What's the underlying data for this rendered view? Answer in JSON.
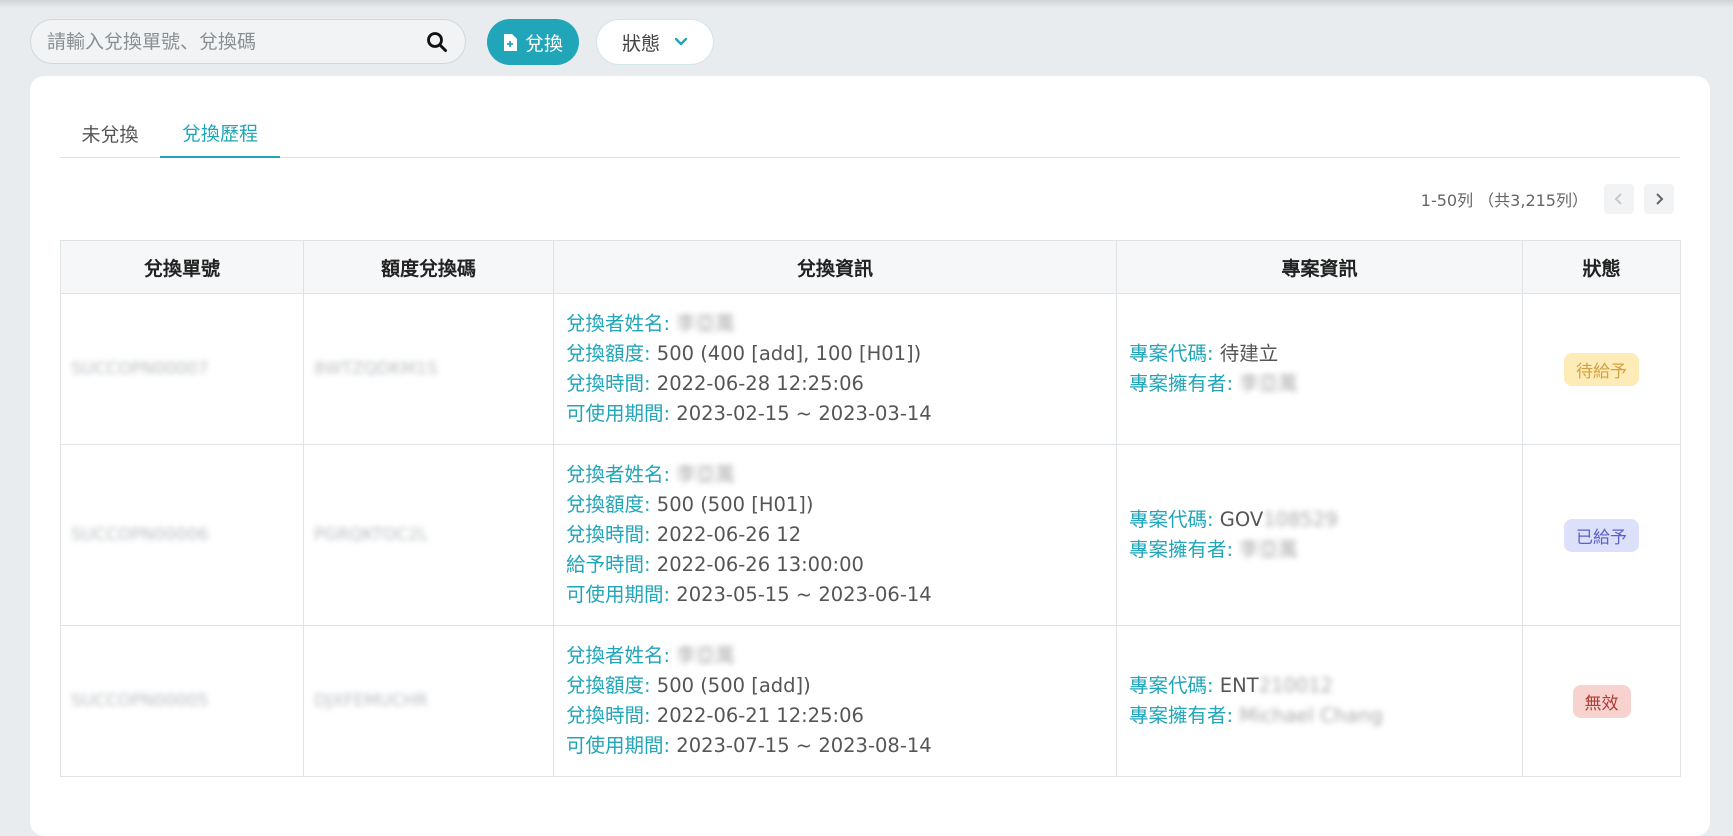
{
  "search": {
    "placeholder": "請輸入兌換單號、兌換碼"
  },
  "toolbar": {
    "exchange_label": "兌換",
    "status_label": "狀態"
  },
  "tabs": [
    {
      "label": "未兌換",
      "active": false
    },
    {
      "label": "兌換歷程",
      "active": true
    }
  ],
  "pagination": {
    "text": "1-50列 （共3,215列）"
  },
  "table": {
    "headers": [
      "兌換單號",
      "額度兌換碼",
      "兌換資訊",
      "專案資訊",
      "狀態"
    ],
    "rows": [
      {
        "order_no": "SUCCOPN00007",
        "code": "8WTZQDKM1S",
        "info": [
          {
            "label": "兌換者姓名:",
            "value": "李亞萬",
            "blurred": true
          },
          {
            "label": "兌換額度:",
            "value": "500 (400 [add], 100 [H01])"
          },
          {
            "label": "兌換時間:",
            "value": "2022-06-28 12:25:06"
          },
          {
            "label": "可使用期間:",
            "value": "2023-02-15 ~ 2023-03-14"
          }
        ],
        "project": {
          "code_label": "專案代碼:",
          "code_value": "待建立",
          "code_suffix": "",
          "owner_label": "專案擁有者:",
          "owner_value": "李亞萬"
        },
        "status": "待給予"
      },
      {
        "order_no": "SUCCOPN00006",
        "code": "PGRQKTOC2L",
        "info": [
          {
            "label": "兌換者姓名:",
            "value": "李亞萬",
            "blurred": true
          },
          {
            "label": "兌換額度:",
            "value": "500 (500 [H01])"
          },
          {
            "label": "兌換時間:",
            "value": "2022-06-26 12"
          },
          {
            "label": "給予時間:",
            "value": "2022-06-26 13:00:00"
          },
          {
            "label": "可使用期間:",
            "value": "2023-05-15 ~ 2023-06-14"
          }
        ],
        "project": {
          "code_label": "專案代碼:",
          "code_value": "GOV",
          "code_suffix": "108529",
          "owner_label": "專案擁有者:",
          "owner_value": "李亞萬"
        },
        "status": "已給予"
      },
      {
        "order_no": "SUCCOPN00005",
        "code": "DJXFEMUCHR",
        "info": [
          {
            "label": "兌換者姓名:",
            "value": "李亞萬",
            "blurred": true
          },
          {
            "label": "兌換額度:",
            "value": "500 (500 [add])"
          },
          {
            "label": "兌換時間:",
            "value": "2022-06-21 12:25:06"
          },
          {
            "label": "可使用期間:",
            "value": "2023-07-15 ~ 2023-08-14"
          }
        ],
        "project": {
          "code_label": "專案代碼:",
          "code_value": "ENT",
          "code_suffix": "210012",
          "owner_label": "專案擁有者:",
          "owner_value": "Michael Chang"
        },
        "status": "無效"
      }
    ]
  }
}
